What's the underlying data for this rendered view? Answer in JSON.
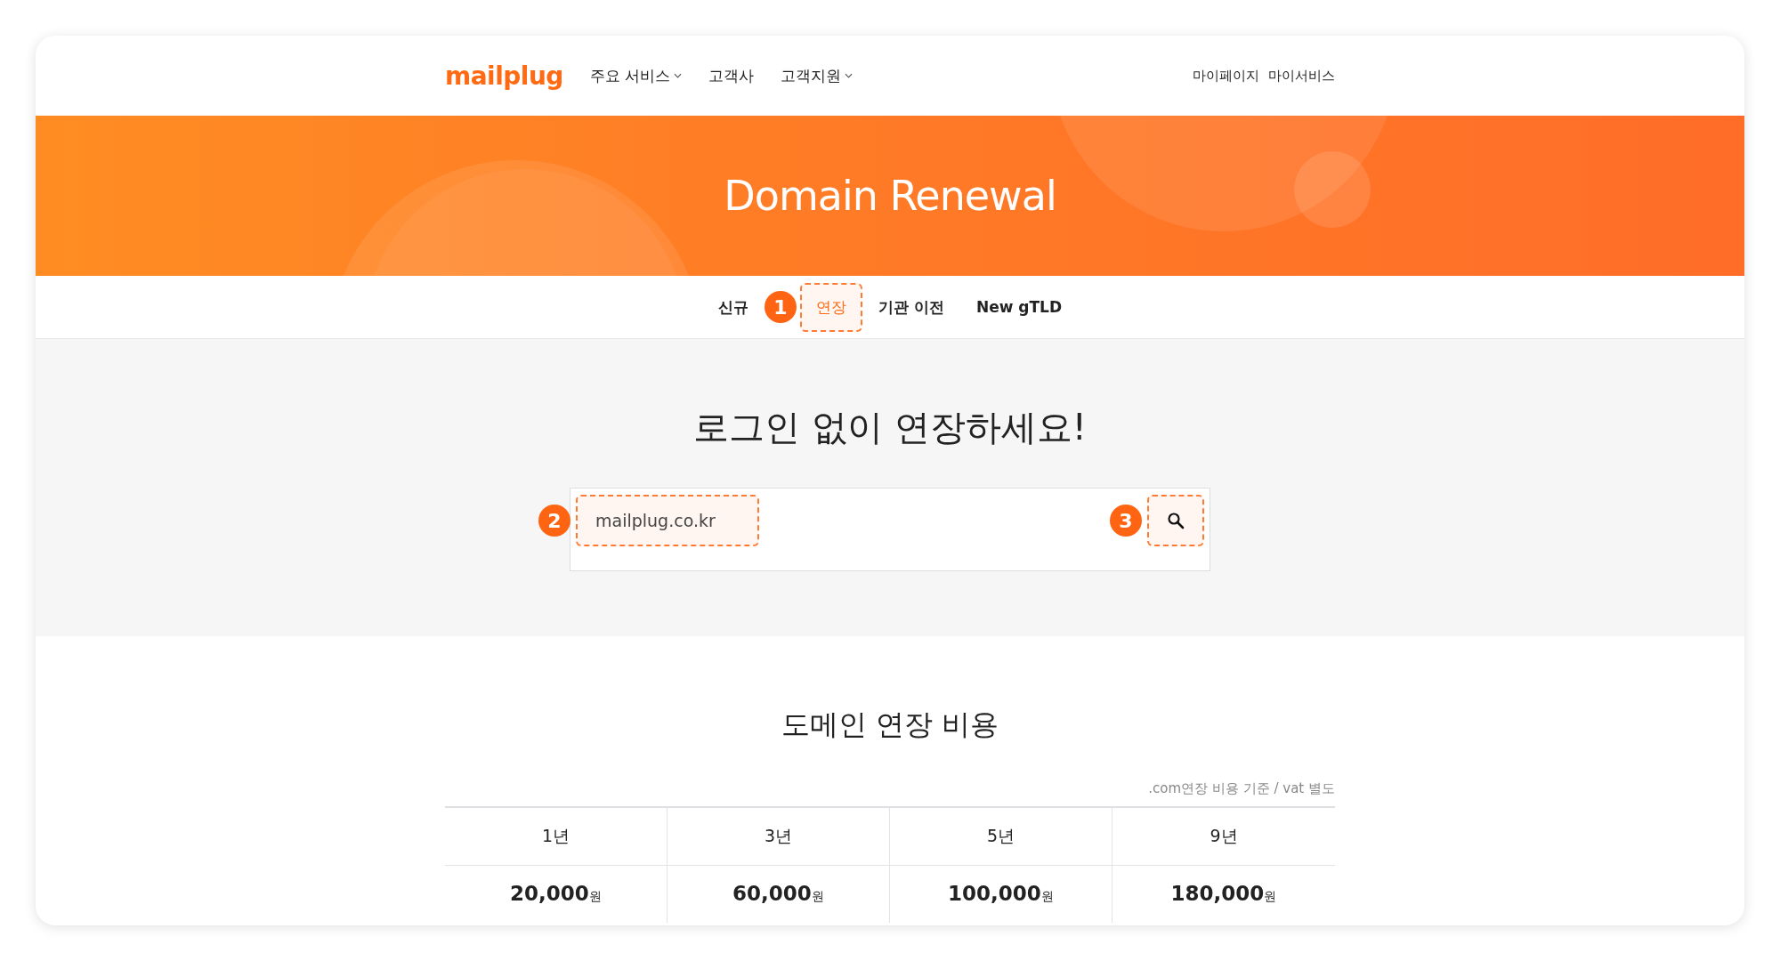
{
  "header": {
    "logo": "mailplug",
    "nav": [
      {
        "label": "주요 서비스",
        "dropdown": true
      },
      {
        "label": "고객사",
        "dropdown": false
      },
      {
        "label": "고객지원",
        "dropdown": true
      }
    ],
    "user_links": [
      "마이페이지",
      "마이서비스"
    ]
  },
  "banner": {
    "title": "Domain Renewal"
  },
  "tabs": [
    {
      "label": "신규",
      "selected": false
    },
    {
      "label": "연장",
      "selected": true,
      "badge": "1"
    },
    {
      "label": "기관 이전",
      "selected": false
    },
    {
      "label": "New gTLD",
      "selected": false
    }
  ],
  "search": {
    "heading": "로그인 없이 연장하세요!",
    "value": "mailplug.co.kr",
    "input_badge": "2",
    "input_highlighted": true,
    "button_badge": "3",
    "button_highlighted": true
  },
  "pricing": {
    "title": "도메인 연장 비용",
    "note": ".com연장 비용 기준 / vat 별도",
    "columns": [
      {
        "period": "1년",
        "amount": "20,000",
        "unit": "원"
      },
      {
        "period": "3년",
        "amount": "60,000",
        "unit": "원"
      },
      {
        "period": "5년",
        "amount": "100,000",
        "unit": "원"
      },
      {
        "period": "9년",
        "amount": "180,000",
        "unit": "원"
      }
    ]
  }
}
